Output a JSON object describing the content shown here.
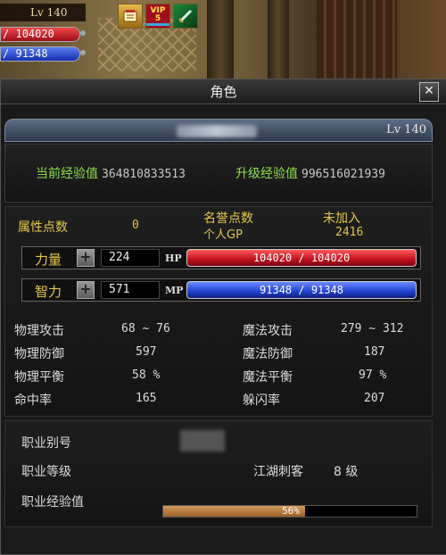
{
  "hud": {
    "level": "Lv 140",
    "hp": "104020",
    "mp": "91348",
    "icons": [
      "scroll-icon",
      "vip-icon",
      "sword-icon"
    ],
    "vip_label": "VIP",
    "vip_level": "5"
  },
  "window": {
    "title": "角色",
    "close_label": "✕"
  },
  "character": {
    "level": "Lv 140"
  },
  "experience": {
    "current_label": "当前经验值",
    "current_value": "364810833513",
    "next_label": "升级经验值",
    "next_value": "996516021939"
  },
  "points": {
    "attr_label": "属性点数",
    "attr_value": "0",
    "fame_label": "名誉点数",
    "fame_value": "未加入",
    "gp_label": "个人GP",
    "gp_value": "2416"
  },
  "attributes": [
    {
      "label": "力量",
      "value": "224",
      "bar_label": "HP",
      "bar_text": "104020 / 104020"
    },
    {
      "label": "智力",
      "value": "571",
      "bar_label": "MP",
      "bar_text": "91348 / 91348"
    }
  ],
  "stats_left": [
    {
      "label": "物理攻击",
      "value": "68 ~ 76"
    },
    {
      "label": "物理防御",
      "value": "597"
    },
    {
      "label": "物理平衡",
      "value": "58 %"
    },
    {
      "label": "命中率",
      "value": "165"
    }
  ],
  "stats_right": [
    {
      "label": "魔法攻击",
      "value": "279 ~ 312"
    },
    {
      "label": "魔法防御",
      "value": "187"
    },
    {
      "label": "魔法平衡",
      "value": "97 %"
    },
    {
      "label": "躲闪率",
      "value": "207"
    }
  ],
  "job": {
    "alias_label": "职业别号",
    "level_label": "职业等级",
    "class_name": "江湖刺客",
    "class_level": "8 级",
    "exp_label": "职业经验值",
    "exp_percent_text": "56%",
    "exp_fraction": 0.56
  },
  "colors": {
    "accent_green": "#8de04a",
    "gold": "#e8c64a",
    "hp_red": "#c0101e",
    "mp_blue": "#2040d0"
  }
}
